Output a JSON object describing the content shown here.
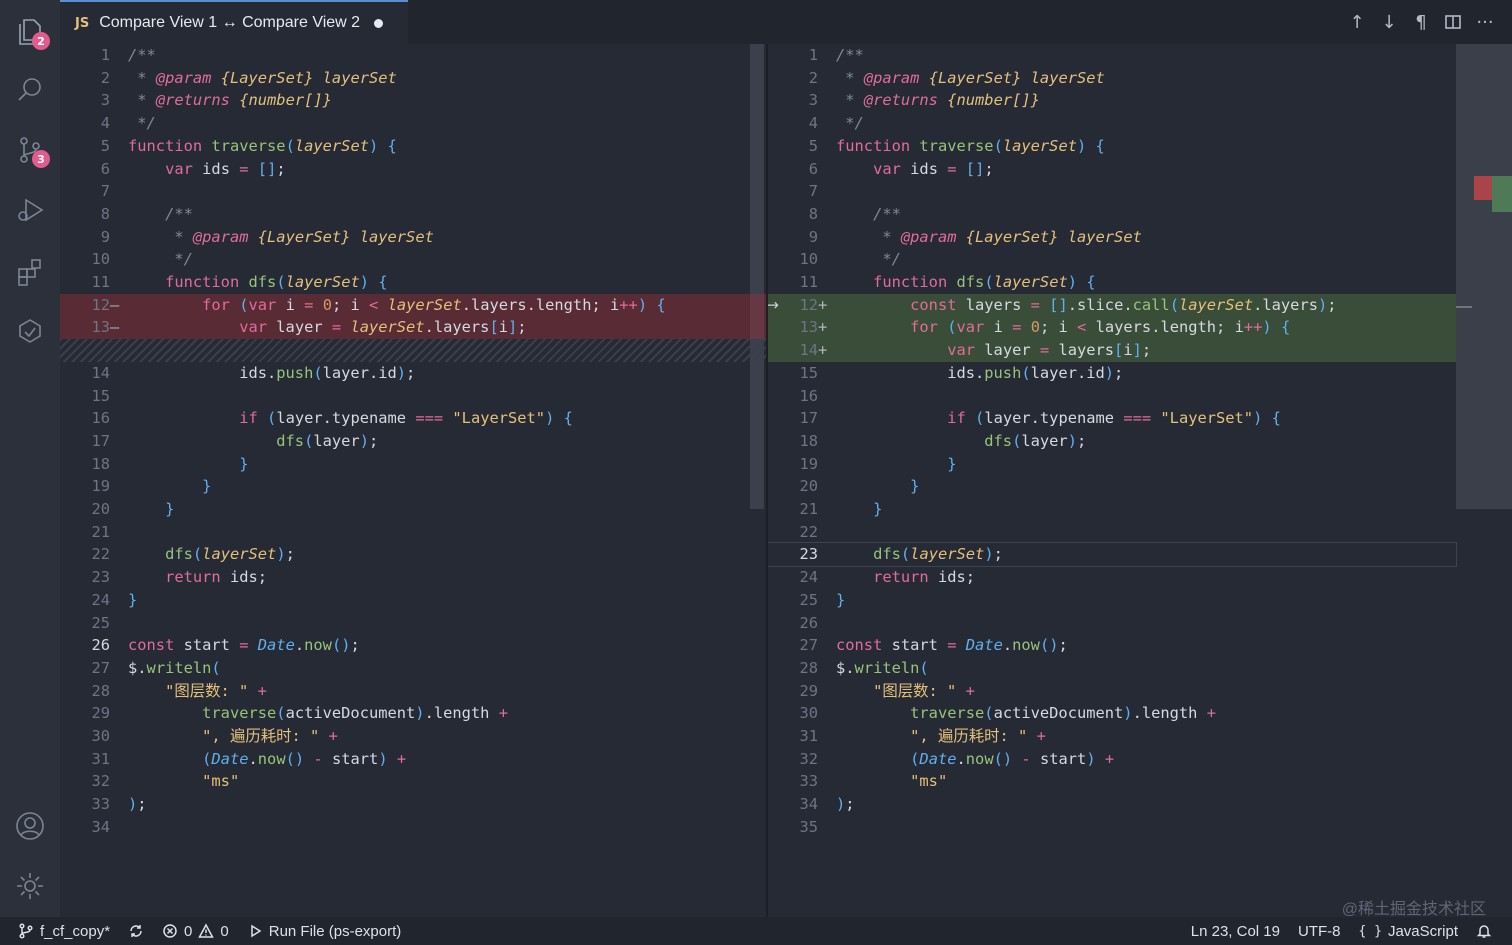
{
  "tab": {
    "lang": "JS",
    "title": "Compare View 1 ↔ Compare View 2"
  },
  "activity_badges": {
    "explorer": "2",
    "scm": "3"
  },
  "tab_actions": [
    "↑",
    "↓",
    "¶"
  ],
  "left_lines": [
    {
      "n": "1"
    },
    {
      "n": "2"
    },
    {
      "n": "3"
    },
    {
      "n": "4"
    },
    {
      "n": "5"
    },
    {
      "n": "6"
    },
    {
      "n": "7"
    },
    {
      "n": "8"
    },
    {
      "n": "9"
    },
    {
      "n": "10"
    },
    {
      "n": "11"
    },
    {
      "n": "12"
    },
    {
      "n": "13"
    },
    {
      "n": ""
    },
    {
      "n": "14"
    },
    {
      "n": "15"
    },
    {
      "n": "16"
    },
    {
      "n": "17"
    },
    {
      "n": "18"
    },
    {
      "n": "19"
    },
    {
      "n": "20"
    },
    {
      "n": "21"
    },
    {
      "n": "22"
    },
    {
      "n": "23"
    },
    {
      "n": "24"
    },
    {
      "n": "25"
    },
    {
      "n": "26"
    },
    {
      "n": "27"
    },
    {
      "n": "28"
    },
    {
      "n": "29"
    },
    {
      "n": "30"
    },
    {
      "n": "31"
    },
    {
      "n": "32"
    },
    {
      "n": "33"
    },
    {
      "n": "34"
    }
  ],
  "right_lines": [
    {
      "n": "1"
    },
    {
      "n": "2"
    },
    {
      "n": "3"
    },
    {
      "n": "4"
    },
    {
      "n": "5"
    },
    {
      "n": "6"
    },
    {
      "n": "7"
    },
    {
      "n": "8"
    },
    {
      "n": "9"
    },
    {
      "n": "10"
    },
    {
      "n": "11"
    },
    {
      "n": "12"
    },
    {
      "n": "13"
    },
    {
      "n": "14"
    },
    {
      "n": "15"
    },
    {
      "n": "16"
    },
    {
      "n": "17"
    },
    {
      "n": "18"
    },
    {
      "n": "19"
    },
    {
      "n": "20"
    },
    {
      "n": "21"
    },
    {
      "n": "22"
    },
    {
      "n": "23"
    },
    {
      "n": "24"
    },
    {
      "n": "25"
    },
    {
      "n": "26"
    },
    {
      "n": "27"
    },
    {
      "n": "28"
    },
    {
      "n": "29"
    },
    {
      "n": "30"
    },
    {
      "n": "31"
    },
    {
      "n": "32"
    },
    {
      "n": "33"
    },
    {
      "n": "34"
    },
    {
      "n": "35"
    }
  ],
  "diff_markers": {
    "removed": "—",
    "added": "+"
  },
  "left_code": [
    "/**",
    " * @param {LayerSet} layerSet",
    " * @returns {number[]}",
    " */",
    "function traverse(layerSet) {",
    "    var ids = [];",
    "",
    "    /**",
    "     * @param {LayerSet} layerSet",
    "     */",
    "    function dfs(layerSet) {",
    "        for (var i = 0; i < layerSet.layers.length; i++) {",
    "            var layer = layerSet.layers[i];",
    "",
    "            ids.push(layer.id);",
    "",
    "            if (layer.typename === \"LayerSet\") {",
    "                dfs(layer);",
    "            }",
    "        }",
    "    }",
    "",
    "    dfs(layerSet);",
    "    return ids;",
    "}",
    "",
    "const start = Date.now();",
    "$.writeln(",
    "    \"图层数: \" +",
    "        traverse(activeDocument).length +",
    "        \", 遍历耗时: \" +",
    "        (Date.now() - start) +",
    "        \"ms\"",
    ");",
    ""
  ],
  "right_code": [
    "/**",
    " * @param {LayerSet} layerSet",
    " * @returns {number[]}",
    " */",
    "function traverse(layerSet) {",
    "    var ids = [];",
    "",
    "    /**",
    "     * @param {LayerSet} layerSet",
    "     */",
    "    function dfs(layerSet) {",
    "        const layers = [].slice.call(layerSet.layers);",
    "        for (var i = 0; i < layers.length; i++) {",
    "            var layer = layers[i];",
    "            ids.push(layer.id);",
    "",
    "            if (layer.typename === \"LayerSet\") {",
    "                dfs(layer);",
    "            }",
    "        }",
    "    }",
    "",
    "    dfs(layerSet);",
    "    return ids;",
    "}",
    "",
    "const start = Date.now();",
    "$.writeln(",
    "    \"图层数: \" +",
    "        traverse(activeDocument).length +",
    "        \", 遍历耗时: \" +",
    "        (Date.now() - start) +",
    "        \"ms\"",
    ");",
    ""
  ],
  "status": {
    "branch": "f_cf_copy*",
    "errors": "0",
    "warnings": "0",
    "run": "Run File (ps-export)",
    "position": "Ln 23, Col 19",
    "encoding": "UTF-8",
    "language": "JavaScript"
  },
  "watermark": "@稀土掘金技术社区",
  "colors": {
    "accent": "#5a8fd6",
    "badge": "#e35a8d",
    "removed": "#a94449",
    "added": "#4e7a57"
  }
}
